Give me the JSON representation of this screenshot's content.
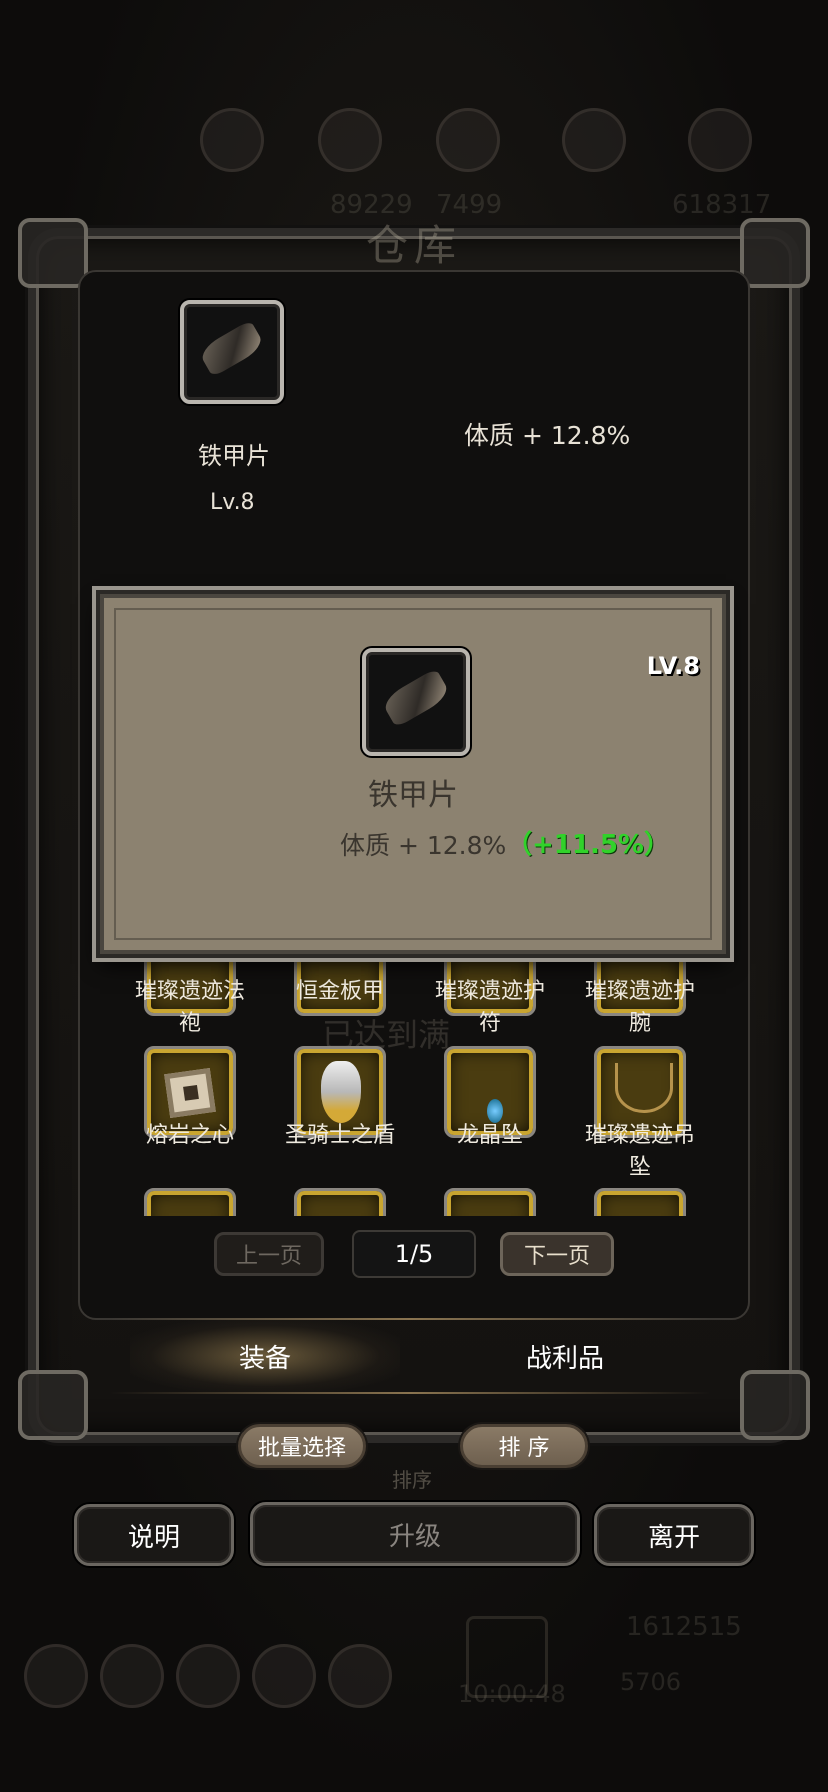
{
  "header": {
    "title": "仓库",
    "ghost_numbers": [
      "89229",
      "7499",
      "618317"
    ]
  },
  "detail": {
    "item_name": "铁甲片",
    "item_level": "Lv.8",
    "stat": "体质 + 12.8%"
  },
  "popup": {
    "item_name": "铁甲片",
    "level": "LV.8",
    "stat": "体质 + 12.8%",
    "stat_bonus": "（+11.5%）",
    "colors": {
      "bonus": "#31d22a",
      "panel": "#8c8270"
    }
  },
  "background_watermark": "已达到满",
  "grid": {
    "row1": [
      {
        "label": "璀璨遗迹法\n袍"
      },
      {
        "label": "恒金板甲"
      },
      {
        "label": "璀璨遗迹护\n符"
      },
      {
        "label": "璀璨遗迹护\n腕"
      }
    ],
    "row2": [
      {
        "label": "熔岩之心",
        "icon": "lava-heart-icon"
      },
      {
        "label": "圣骑士之盾",
        "icon": "paladin-shield-icon"
      },
      {
        "label": "龙晶坠",
        "icon": "dragon-crystal-pendant-icon"
      },
      {
        "label": "璀璨遗迹吊\n坠",
        "icon": "relic-necklace-icon"
      }
    ]
  },
  "pagination": {
    "prev": "上一页",
    "next": "下一页",
    "indicator": "1/5"
  },
  "tabs": [
    {
      "label": "装备",
      "active": true
    },
    {
      "label": "战利品",
      "active": false
    }
  ],
  "actions": {
    "batch_select": "批量选择",
    "sort": "排 序",
    "sort_ghost": "排序"
  },
  "bottom": {
    "help": "说明",
    "upgrade": "升级",
    "leave": "离开"
  },
  "background_footer": {
    "gold": "1612515",
    "gems": "5706",
    "timer": "10:00:48"
  }
}
